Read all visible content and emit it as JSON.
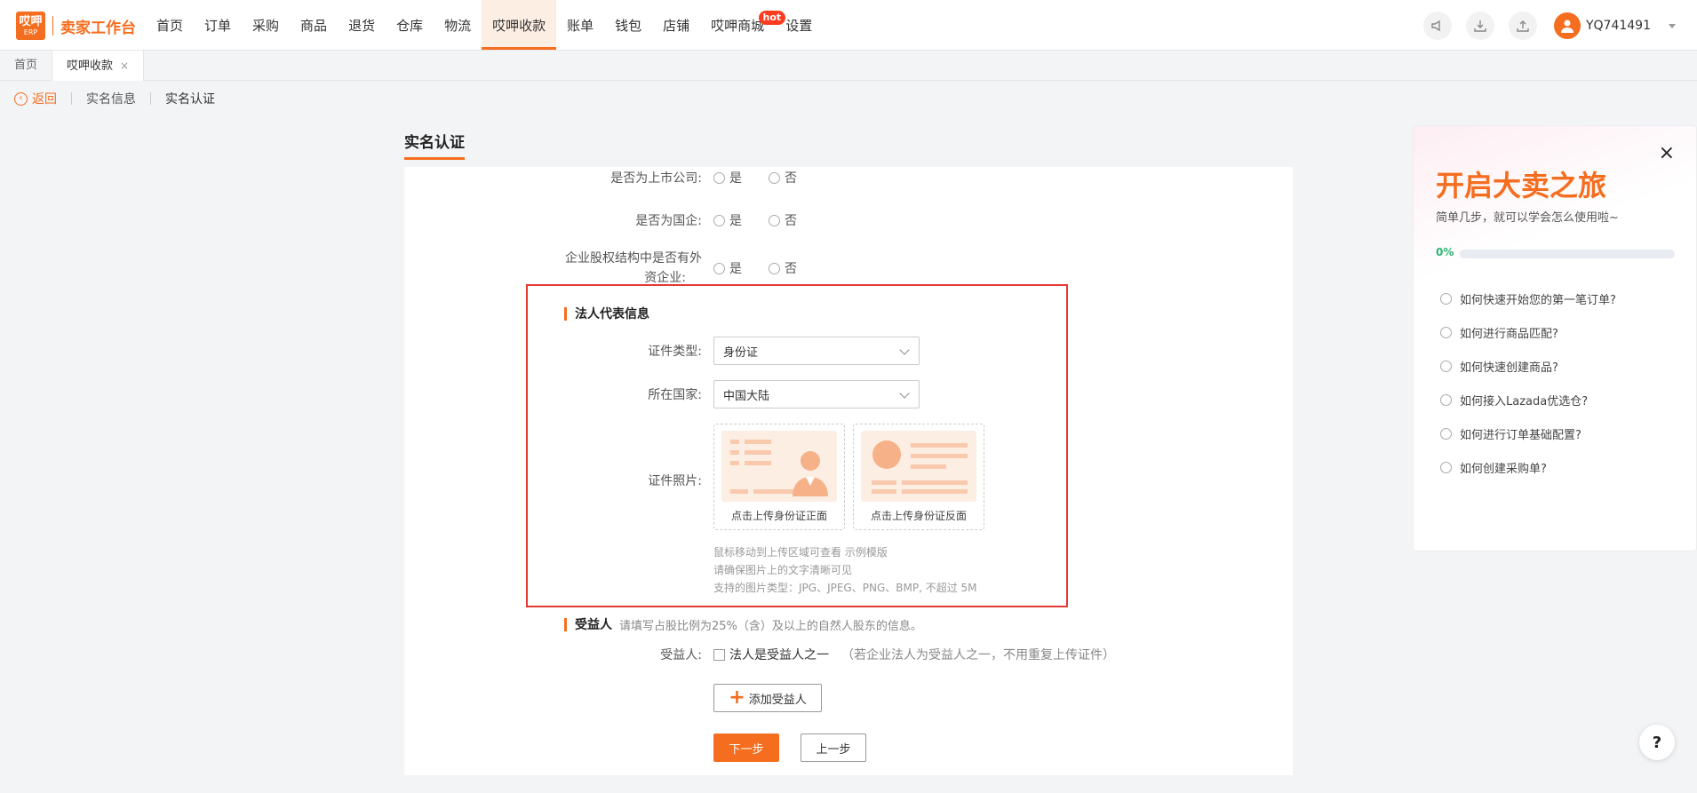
{
  "logo": {
    "box_line1": "哎呷",
    "box_line2": "ERP",
    "text": "卖家工作台"
  },
  "nav": {
    "items": [
      "首页",
      "订单",
      "采购",
      "商品",
      "退货",
      "仓库",
      "物流",
      "哎呷收款",
      "账单",
      "钱包",
      "店铺",
      "哎呷商城",
      "设置"
    ],
    "active": "哎呷收款",
    "hot_badge": "hot"
  },
  "header_icons": [
    "announcement-icon",
    "download-icon",
    "upload-icon"
  ],
  "user": {
    "name": "YQ741491"
  },
  "page_tabs": {
    "home": "首页",
    "current": "哎呷收款",
    "close": "×"
  },
  "breadcrumb": {
    "back": "返回",
    "item1": "实名信息",
    "item2": "实名认证"
  },
  "page_title": "实名认证",
  "form": {
    "listed": {
      "label": "是否为上市公司:",
      "yes": "是",
      "no": "否"
    },
    "soe": {
      "label": "是否为国企:",
      "yes": "是",
      "no": "否"
    },
    "foreign": {
      "label_line1": "企业股权结构中是否有外",
      "label_line2": "资企业:",
      "yes": "是",
      "no": "否"
    },
    "legal_section": "法人代表信息",
    "id_type": {
      "label": "证件类型:",
      "value": "身份证"
    },
    "country": {
      "label": "所在国家:",
      "value": "中国大陆"
    },
    "id_photo": {
      "label": "证件照片:",
      "front": "点击上传身份证正面",
      "back": "点击上传身份证反面"
    },
    "tips": [
      "鼠标移动到上传区域可查看 示例模版",
      "请确保图片上的文字清晰可见",
      "支持的图片类型：JPG、JPEG、PNG、BMP, 不超过 5M"
    ],
    "beneficiary_section": "受益人",
    "beneficiary_hint": "请填写占股比例为25%（含）及以上的自然人股东的信息。",
    "beneficiary": {
      "label": "受益人:",
      "checkbox": "法人是受益人之一",
      "note": "（若企业法人为受益人之一，不用重复上传证件）"
    },
    "add_beneficiary": "添加受益人",
    "next": "下一步",
    "prev": "上一步"
  },
  "guide": {
    "title": "开启大卖之旅",
    "subtitle": "简单几步，就可以学会怎么使用啦~",
    "progress_label": "0%",
    "progress": 0,
    "close": "×",
    "questions": [
      "如何快速开始您的第一笔订单?",
      "如何进行商品匹配?",
      "如何快速创建商品?",
      "如何接入Lazada优选仓?",
      "如何进行订单基础配置?",
      "如何创建采购单?"
    ]
  },
  "help": "?",
  "colors": {
    "accent": "#f56d1e",
    "highlight": "#e53935",
    "progress": "#2bb673"
  }
}
